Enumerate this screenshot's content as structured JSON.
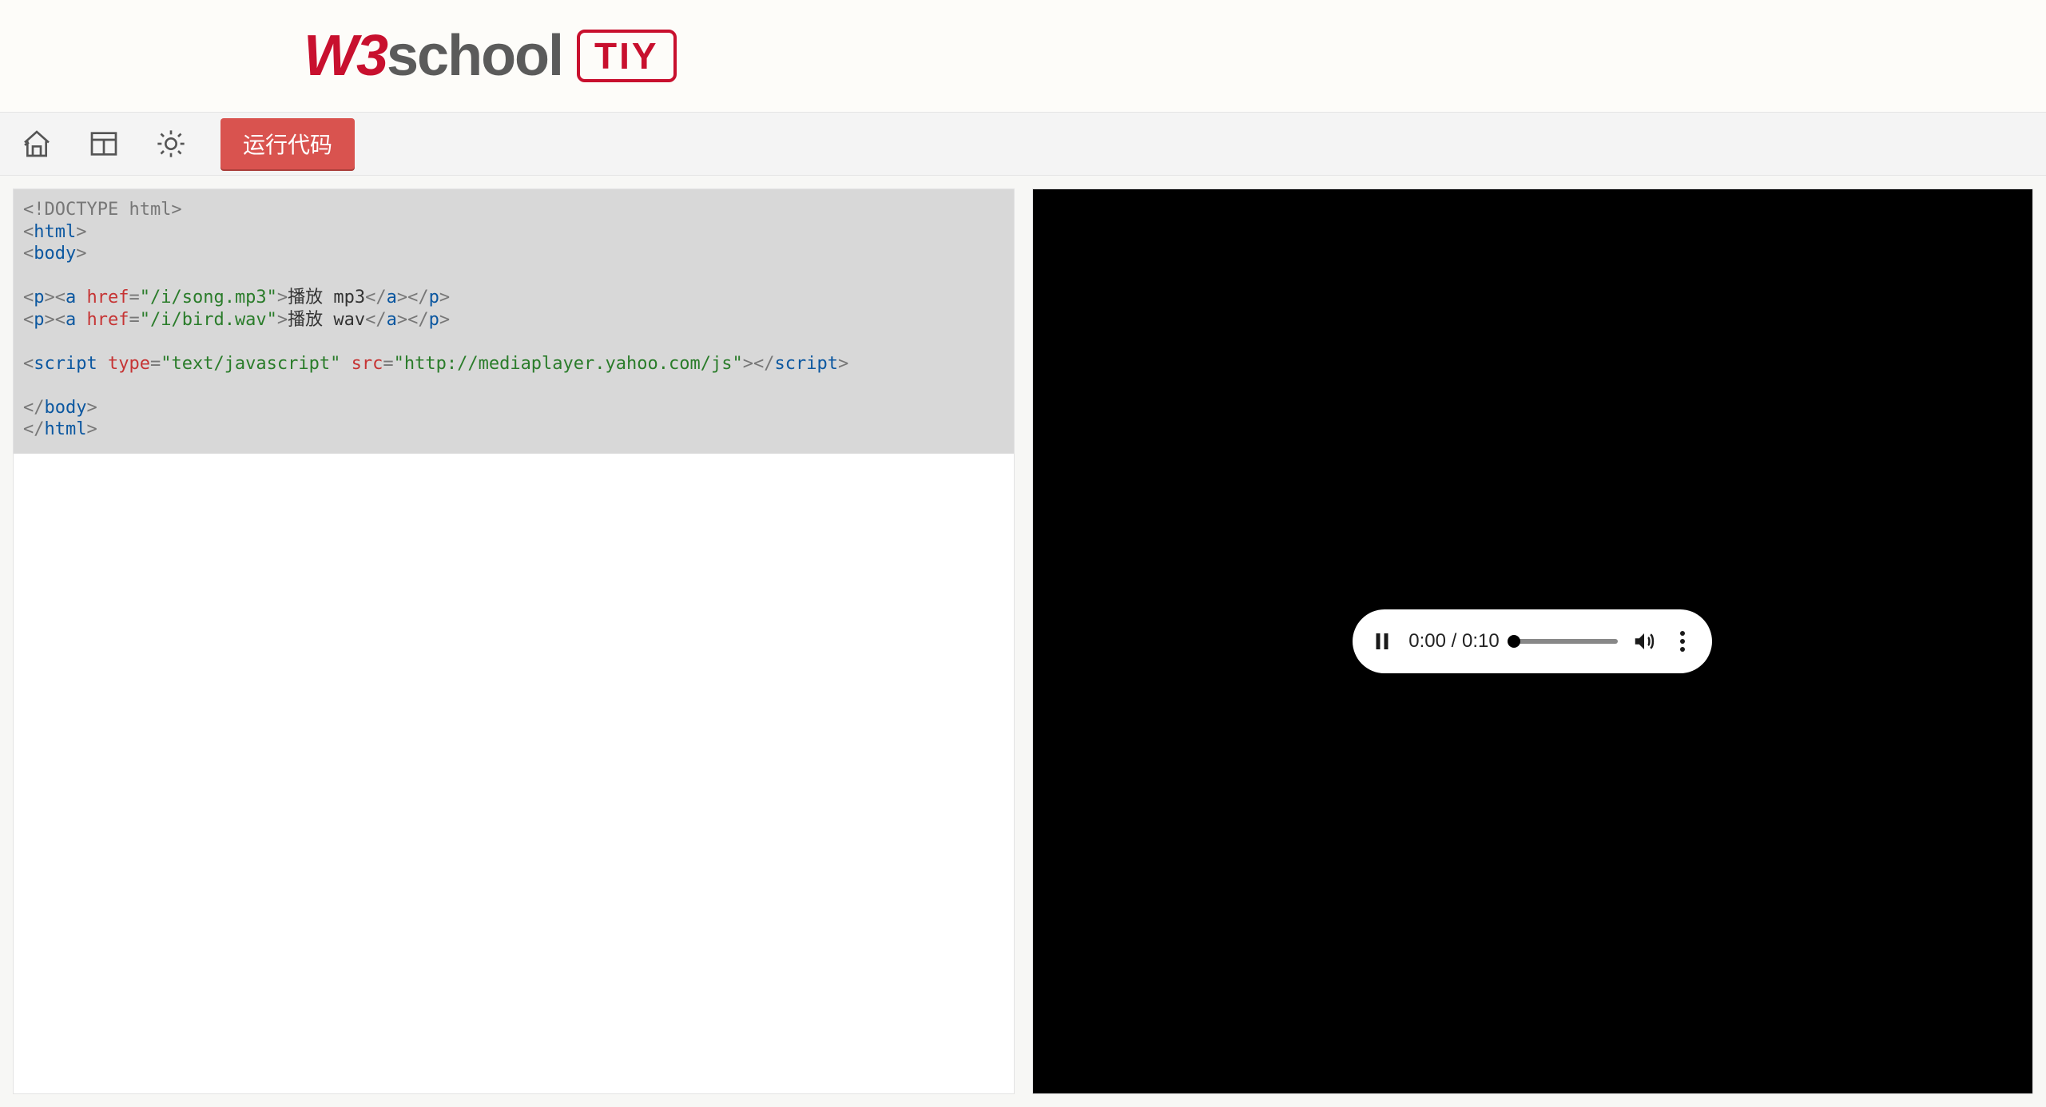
{
  "header": {
    "logo_w3": "W3",
    "logo_rest": "school",
    "tiy_badge": "TIY"
  },
  "toolbar": {
    "run_label": "运行代码"
  },
  "editor": {
    "t1": "<!DOCTYPE html>",
    "t2a": "<",
    "t2b": "html",
    "t2c": ">",
    "t3a": "<",
    "t3b": "body",
    "t3c": ">",
    "l1a": "<",
    "l1b": "p",
    "l1c": "><",
    "l1d": "a",
    "l1e": " href",
    "l1f": "=",
    "l1g": "\"/i/song.mp3\"",
    "l1h": ">",
    "l1i": "播放 mp3",
    "l1j": "</",
    "l1k": "a",
    "l1l": "></",
    "l1m": "p",
    "l1n": ">",
    "l2a": "<",
    "l2b": "p",
    "l2c": "><",
    "l2d": "a",
    "l2e": " href",
    "l2f": "=",
    "l2g": "\"/i/bird.wav\"",
    "l2h": ">",
    "l2i": "播放 wav",
    "l2j": "</",
    "l2k": "a",
    "l2l": "></",
    "l2m": "p",
    "l2n": ">",
    "sa": "<",
    "sb": "script",
    "sc": " type",
    "sd": "=",
    "se": "\"text/javascript\"",
    "sf": " src",
    "sg": "=",
    "sh": "\"http://mediaplayer.yahoo.com/js\"",
    "si": "></",
    "sj": "script",
    "sk": ">",
    "c1a": "</",
    "c1b": "body",
    "c1c": ">",
    "c2a": "</",
    "c2b": "html",
    "c2c": ">"
  },
  "media": {
    "time_display": "0:00 / 0:10"
  }
}
